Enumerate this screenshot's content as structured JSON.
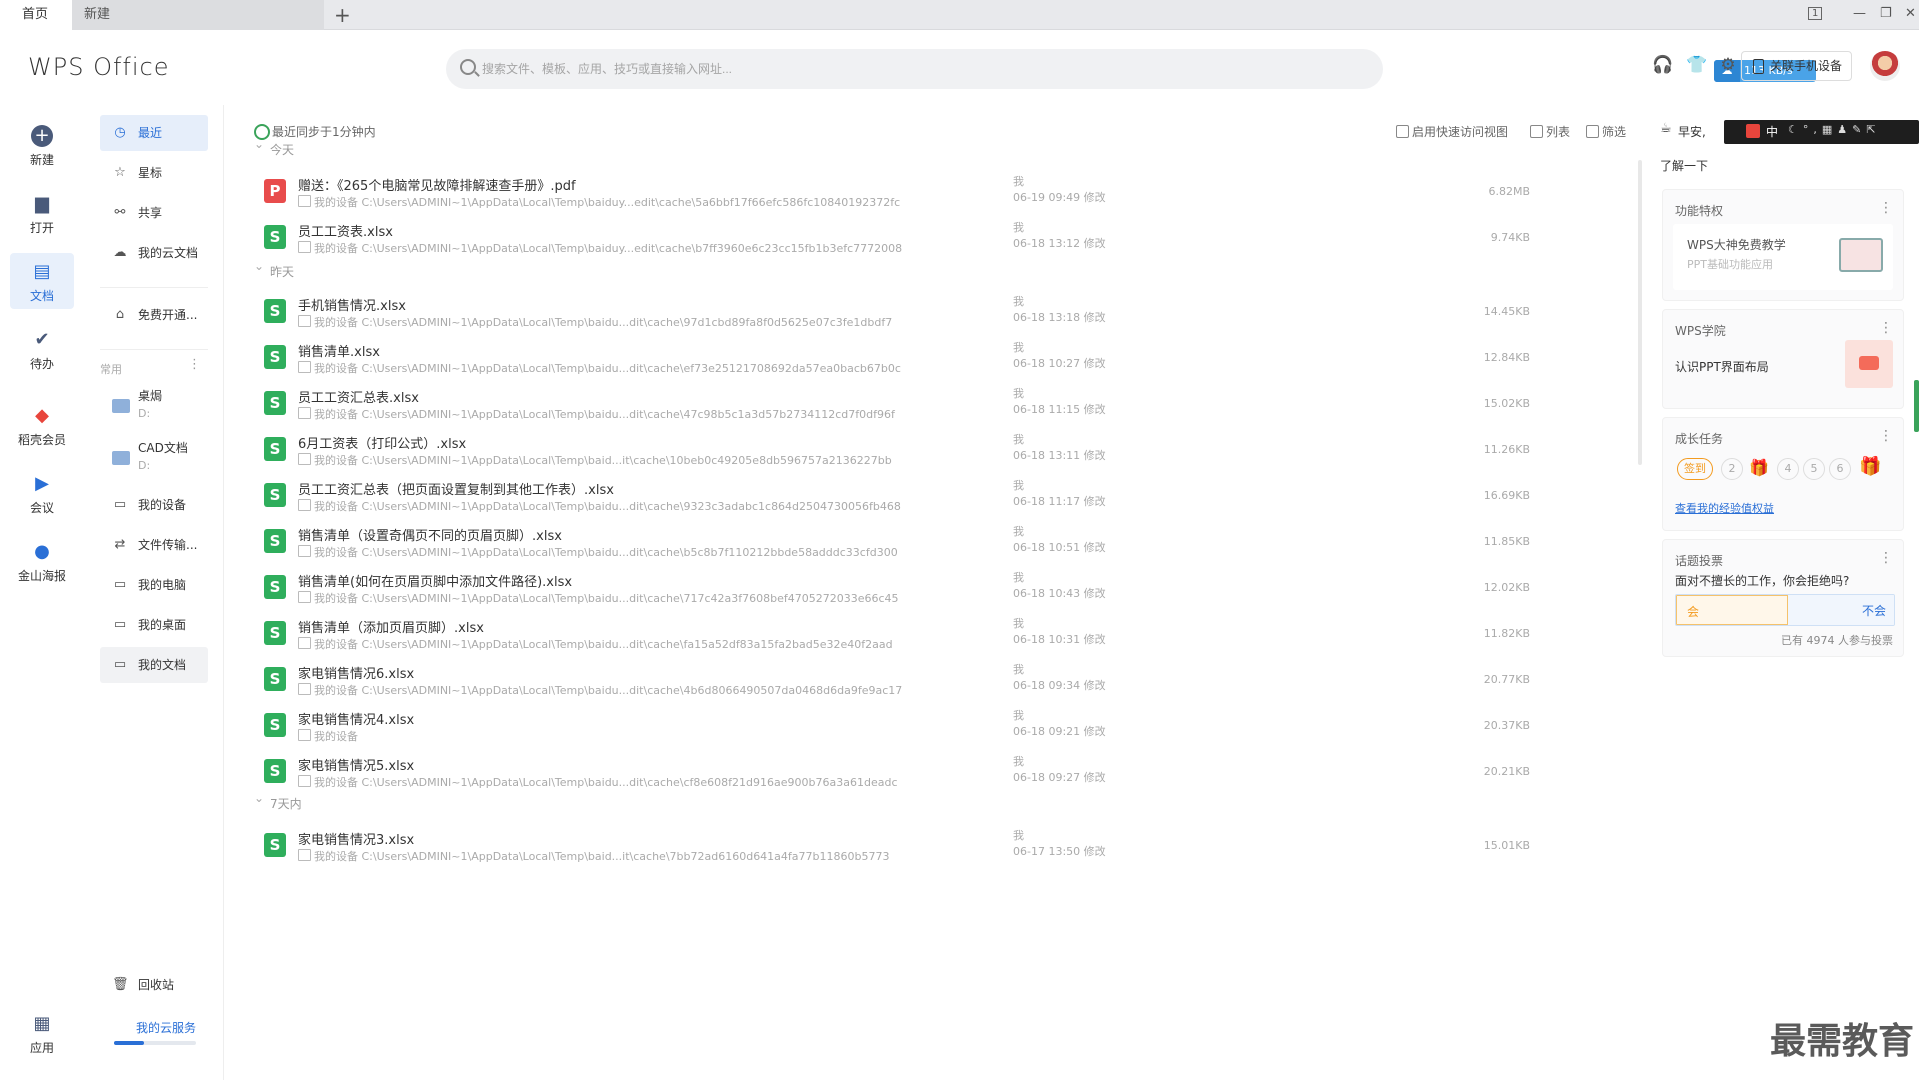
{
  "tabs": {
    "home": "首页",
    "new": "新建",
    "add": "+"
  },
  "window_controls": {
    "layout": "1",
    "minimize": "—",
    "restore": "❐",
    "close": "✕"
  },
  "header": {
    "logo": "WPS Office",
    "search_placeholder": "搜索文件、模板、应用、技巧或直接输入网址...",
    "bind_phone": "关联手机设备",
    "speed": "113 KB/s"
  },
  "nav": [
    {
      "label": "新建",
      "icon": "plus-circle-icon"
    },
    {
      "label": "打开",
      "icon": "folder-icon"
    },
    {
      "label": "文档",
      "icon": "document-icon"
    },
    {
      "label": "待办",
      "icon": "todo-icon"
    },
    {
      "label": "稻壳会员",
      "icon": "docer-icon"
    },
    {
      "label": "会议",
      "icon": "meeting-icon"
    },
    {
      "label": "金山海报",
      "icon": "poster-icon"
    },
    {
      "label": "应用",
      "icon": "apps-grid-icon"
    }
  ],
  "sub": {
    "items": [
      {
        "label": "最近",
        "icon": "clock-icon"
      },
      {
        "label": "星标",
        "icon": "star-icon"
      },
      {
        "label": "共享",
        "icon": "share-icon"
      },
      {
        "label": "我的云文档",
        "icon": "cloud-icon"
      },
      {
        "label": "免费开通...",
        "icon": "building-icon"
      }
    ],
    "common_label": "常用",
    "locations": [
      {
        "label": "桌焗",
        "drive": "D:"
      },
      {
        "label": "CAD文档",
        "drive": "D:"
      }
    ],
    "devices": [
      {
        "label": "我的设备"
      },
      {
        "label": "文件传输..."
      },
      {
        "label": "我的电脑"
      },
      {
        "label": "我的桌面"
      },
      {
        "label": "我的文档"
      }
    ],
    "recycle": "回收站",
    "cloud_service": "我的云服务"
  },
  "main": {
    "sync": "最近同步于1分钟内",
    "tool_quick": "启用快速访问视图",
    "tool_list": "列表",
    "tool_filter": "筛选",
    "groups": {
      "today": "今天",
      "yesterday": "昨天",
      "week": "7天内"
    },
    "files": [
      {
        "name": "赠送：《265个电脑常见故障排解速查手册》.pdf",
        "type": "pdf",
        "path": "我的设备 C:\\Users\\ADMINI~1\\AppData\\Local\\Temp\\baiduy...edit\\cache\\5a6bbf17f66efc586fc10840192372fc",
        "owner": "我",
        "time": "06-19 09:49 修改",
        "size": "6.82MB"
      },
      {
        "name": "员工工资表.xlsx",
        "type": "xlsx",
        "path": "我的设备 C:\\Users\\ADMINI~1\\AppData\\Local\\Temp\\baiduy...edit\\cache\\b7ff3960e6c23cc15fb1b3efc7772008",
        "owner": "我",
        "time": "06-18 13:12 修改",
        "size": "9.74KB"
      },
      {
        "name": "手机销售情况.xlsx",
        "type": "xlsx",
        "path": "我的设备 C:\\Users\\ADMINI~1\\AppData\\Local\\Temp\\baidu...dit\\cache\\97d1cbd89fa8f0d5625e07c3fe1dbdf7",
        "owner": "我",
        "time": "06-18 13:18 修改",
        "size": "14.45KB"
      },
      {
        "name": "销售清单.xlsx",
        "type": "xlsx",
        "path": "我的设备 C:\\Users\\ADMINI~1\\AppData\\Local\\Temp\\baidu...dit\\cache\\ef73e25121708692da57ea0bacb67b0c",
        "owner": "我",
        "time": "06-18 10:27 修改",
        "size": "12.84KB"
      },
      {
        "name": "员工工资汇总表.xlsx",
        "type": "xlsx",
        "path": "我的设备 C:\\Users\\ADMINI~1\\AppData\\Local\\Temp\\baidu...dit\\cache\\47c98b5c1a3d57b2734112cd7f0df96f",
        "owner": "我",
        "time": "06-18 11:15 修改",
        "size": "15.02KB"
      },
      {
        "name": "6月工资表（打印公式）.xlsx",
        "type": "xlsx",
        "path": "我的设备 C:\\Users\\ADMINI~1\\AppData\\Local\\Temp\\baid...it\\cache\\10beb0c49205e8db596757a2136227bb",
        "owner": "我",
        "time": "06-18 13:11 修改",
        "size": "11.26KB"
      },
      {
        "name": "员工工资汇总表（把页面设置复制到其他工作表）.xlsx",
        "type": "xlsx",
        "path": "我的设备 C:\\Users\\ADMINI~1\\AppData\\Local\\Temp\\baidu...dit\\cache\\9323c3adabc1c864d2504730056fb468",
        "owner": "我",
        "time": "06-18 11:17 修改",
        "size": "16.69KB"
      },
      {
        "name": "销售清单（设置奇偶页不同的页眉页脚）.xlsx",
        "type": "xlsx",
        "path": "我的设备 C:\\Users\\ADMINI~1\\AppData\\Local\\Temp\\baidu...dit\\cache\\b5c8b7f110212bbde58adddc33cfd300",
        "owner": "我",
        "time": "06-18 10:51 修改",
        "size": "11.85KB"
      },
      {
        "name": "销售清单(如何在页眉页脚中添加文件路径).xlsx",
        "type": "xlsx",
        "path": "我的设备 C:\\Users\\ADMINI~1\\AppData\\Local\\Temp\\baidu...dit\\cache\\717c42a3f7608bef4705272033e66c45",
        "owner": "我",
        "time": "06-18 10:43 修改",
        "size": "12.02KB"
      },
      {
        "name": "销售清单（添加页眉页脚）.xlsx",
        "type": "xlsx",
        "path": "我的设备 C:\\Users\\ADMINI~1\\AppData\\Local\\Temp\\baidu...dit\\cache\\fa15a52df83a15fa2bad5e32e40f2aad",
        "owner": "我",
        "time": "06-18 10:31 修改",
        "size": "11.82KB"
      },
      {
        "name": "家电销售情况6.xlsx",
        "type": "xlsx",
        "path": "我的设备 C:\\Users\\ADMINI~1\\AppData\\Local\\Temp\\baidu...dit\\cache\\4b6d8066490507da0468d6da9fe9ac17",
        "owner": "我",
        "time": "06-18 09:34 修改",
        "size": "20.77KB"
      },
      {
        "name": "家电销售情况4.xlsx",
        "type": "xlsx",
        "path": "我的设备",
        "owner": "我",
        "time": "06-18 09:21 修改",
        "size": "20.37KB"
      },
      {
        "name": "家电销售情况5.xlsx",
        "type": "xlsx",
        "path": "我的设备 C:\\Users\\ADMINI~1\\AppData\\Local\\Temp\\baidu...dit\\cache\\cf8e608f21d916ae900b76a3a61deadc",
        "owner": "我",
        "time": "06-18 09:27 修改",
        "size": "20.21KB"
      },
      {
        "name": "家电销售情况3.xlsx",
        "type": "xlsx",
        "path": "我的设备 C:\\Users\\ADMINI~1\\AppData\\Local\\Temp\\baid...it\\cache\\7bb72ad6160d641a4fa77b11860b5773",
        "owner": "我",
        "time": "06-17 13:50 修改",
        "size": "15.01KB"
      }
    ]
  },
  "right": {
    "greeting": "早安,",
    "learn": "了解一下",
    "card1": {
      "title": "功能特权",
      "heading": "WPS大神免费教学",
      "sub": "PPT基础功能应用"
    },
    "card2": {
      "title": "WPS学院",
      "text": "认识PPT界面布局"
    },
    "card3": {
      "title": "成长任务",
      "signin": "签到",
      "steps": [
        "2",
        "4",
        "5",
        "6"
      ],
      "link": "查看我的经验值权益"
    },
    "card4": {
      "title": "话题投票",
      "question": "面对不擅长的工作，你会拒绝吗?",
      "yes": "会",
      "no": "不会",
      "count": "已有 4974 人参与投票"
    },
    "ime": "中"
  },
  "watermark": "最需教育"
}
